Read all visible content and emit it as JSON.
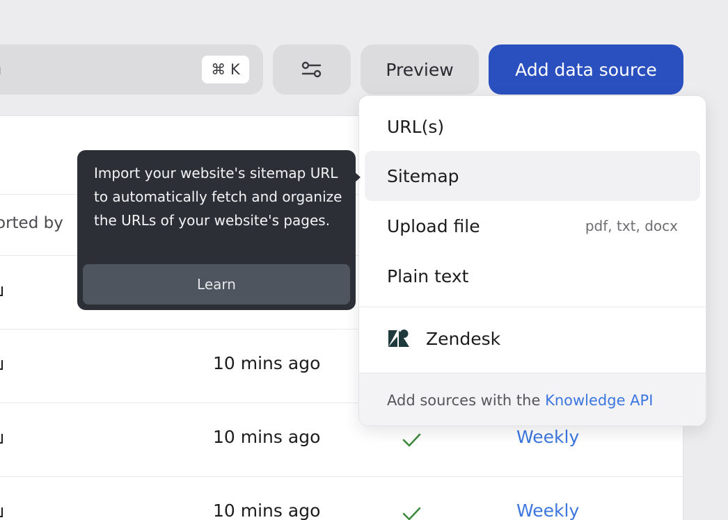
{
  "toolbar": {
    "search_placeholder": "arch",
    "shortcut": "⌘ K",
    "filter_icon": "sliders-icon",
    "preview_label": "Preview",
    "add_label": "Add data source",
    "accent_color": "#2a50c0"
  },
  "table": {
    "column_fragment": "orted by",
    "rows": [
      {
        "time": "",
        "status": "",
        "frequency": ""
      },
      {
        "time": "10 mins ago",
        "status": "",
        "frequency": ""
      },
      {
        "time": "10 mins ago",
        "status": "check-icon",
        "frequency": "Weekly"
      },
      {
        "time": "10 mins ago",
        "status": "check-icon",
        "frequency": "Weekly"
      }
    ],
    "link_color": "#3b76e0",
    "check_color": "#3e8a3e"
  },
  "menu": {
    "items": [
      {
        "label": "URL(s)",
        "hint": ""
      },
      {
        "label": "Sitemap",
        "hint": ""
      },
      {
        "label": "Upload file",
        "hint": "pdf, txt, docx"
      },
      {
        "label": "Plain text",
        "hint": ""
      }
    ],
    "integration": {
      "label": "Zendesk",
      "icon": "zendesk-icon"
    },
    "footer_text": "Add sources with the ",
    "footer_link": "Knowledge API"
  },
  "tooltip": {
    "text": "Import your website's sitemap URL to automatically fetch and organize the URLs of your website's pages.",
    "button": "Learn"
  }
}
